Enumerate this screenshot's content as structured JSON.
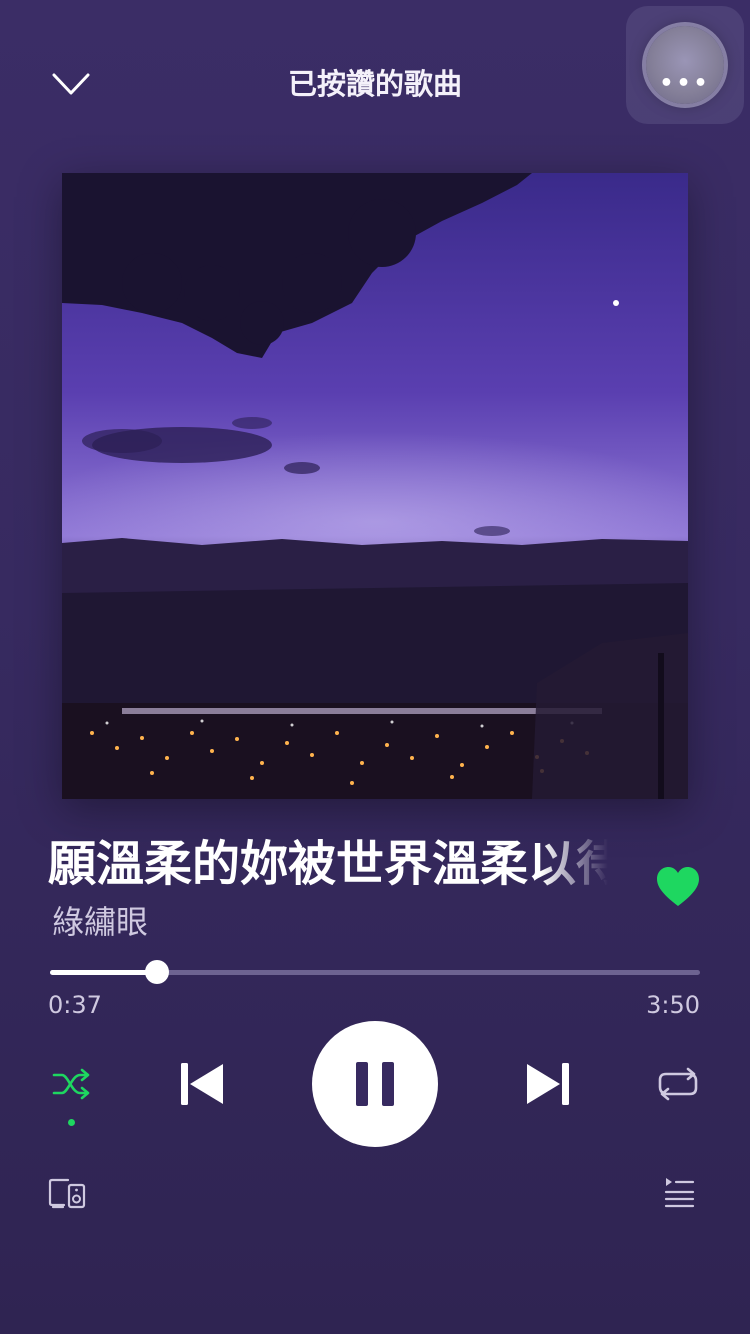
{
  "header": {
    "title": "已按讚的歌曲",
    "collapse_icon": "chevron-down-icon",
    "overlay_icon": "more-dots-icon",
    "overlay_label": "•••"
  },
  "album": {
    "icon": "album-art-night-city"
  },
  "track": {
    "title": "願溫柔的妳被世界溫柔以待",
    "artist": "綠繡眼",
    "liked": true
  },
  "playback": {
    "current_time": "0:37",
    "total_time": "3:50",
    "progress": 0.165,
    "state": "playing",
    "shuffle_on": true,
    "repeat": "off"
  },
  "colors": {
    "background": "#372a60",
    "accent_green": "#1ed760",
    "track_unfilled": "#6d6391",
    "secondary_text": "#cfc9e0"
  }
}
